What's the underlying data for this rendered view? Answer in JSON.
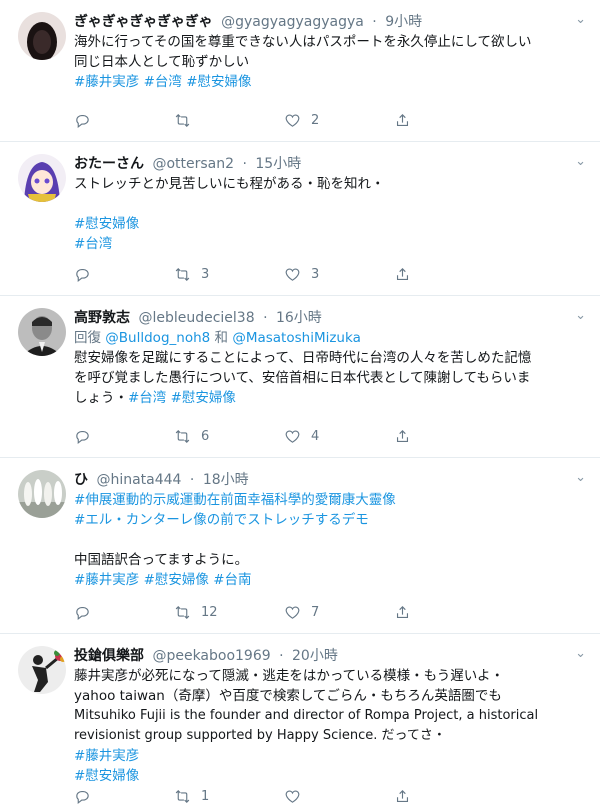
{
  "tweets": [
    {
      "display_name": "ぎゃぎゃぎゃぎゃぎゃ",
      "handle": "@gyagyagyagyagya",
      "time": "9小時",
      "lines": [
        {
          "t": "海外に行ってその国を尊重できない人はパスポートを永久停止にして欲しい"
        },
        {
          "t": "同じ日本人として恥ずかしい"
        }
      ],
      "hashtags": "#藤井実彦 #台湾 #慰安婦像",
      "counts": {
        "reply": "",
        "retweet": "",
        "like": "2"
      }
    },
    {
      "display_name": "おたーさん",
      "handle": "@ottersan2",
      "time": "15小時",
      "lines": [
        {
          "t": "ストレッチとか見苦しいにも程がある・恥を知れ・"
        }
      ],
      "hashtag_lines": [
        "#慰安婦像",
        "#台湾"
      ],
      "counts": {
        "reply": "",
        "retweet": "3",
        "like": "3"
      }
    },
    {
      "display_name": "高野敦志",
      "handle": "@lebleudeciel38",
      "time": "16小時",
      "reply_prefix": "回復",
      "reply_to_1": "@Bulldog_noh8",
      "reply_and": "和",
      "reply_to_2": "@MasatoshiMizuka",
      "lines": [
        {
          "t": "慰安婦像を足蹴にすることによって、日帝時代に台湾の人々を苦しめた記憶"
        },
        {
          "t": "を呼び覚ました愚行について、安倍首相に日本代表として陳謝してもらいま"
        },
        {
          "t": "しょう・",
          "h": "#台湾 #慰安婦像"
        }
      ],
      "counts": {
        "reply": "",
        "retweet": "6",
        "like": "4"
      }
    },
    {
      "display_name": "ひ",
      "handle": "@hinata444",
      "time": "18小時",
      "hashtag_lines": [
        "#伸展運動的示威運動在前面幸福科學的愛爾康大靈像",
        "#エル・カンターレ像の前でストレッチするデモ"
      ],
      "body": "中国語訳合ってますように。",
      "hashtags": "#藤井実彦 #慰安婦像 #台南",
      "counts": {
        "reply": "",
        "retweet": "12",
        "like": "7"
      }
    },
    {
      "display_name": "投鎗俱樂部",
      "handle": "@peekaboo1969",
      "time": "20小時",
      "lines": [
        {
          "t": "藤井実彦が必死になって隠滅・逃走をはかっている模様・もう遅いよ・"
        },
        {
          "t": "yahoo taiwan（奇摩）や百度で検索してごらん・もちろん英語圏でも"
        },
        {
          "t": "Mitsuhiko Fujii is the founder and director of Rompa Project, a historical"
        },
        {
          "t": "revisionist group supported by Happy Science. だってさ・"
        }
      ],
      "hashtag_lines": [
        "#藤井実彦",
        "#慰安婦像"
      ],
      "counts": {
        "reply": "",
        "retweet": "1",
        "like": ""
      }
    }
  ]
}
